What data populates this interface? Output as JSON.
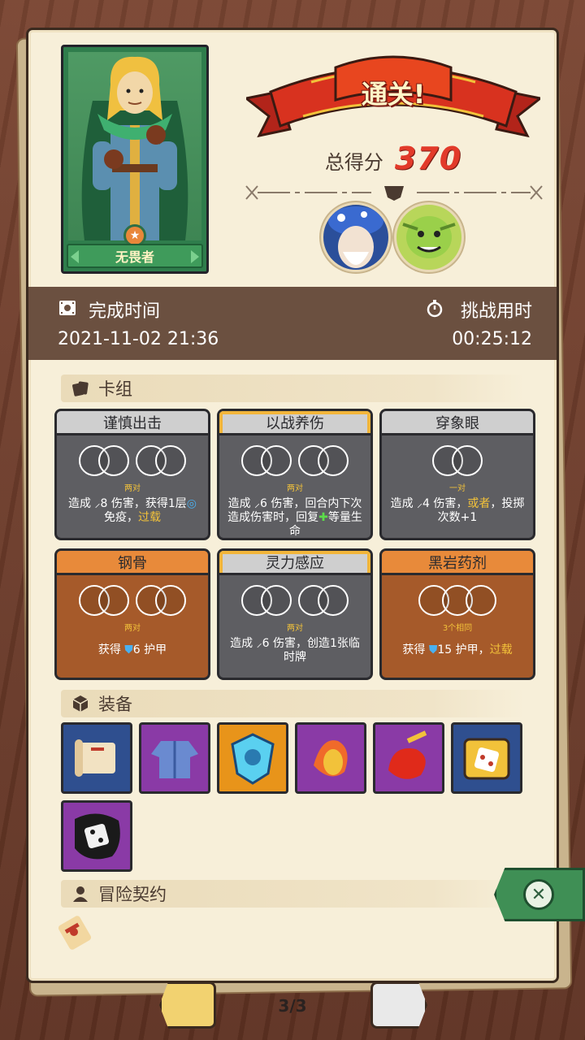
{
  "hero": {
    "name": "无畏者"
  },
  "result": {
    "banner": "通关!",
    "score_label": "总得分",
    "score_value": "370"
  },
  "times": {
    "finish_label": "完成时间",
    "finish_value": "2021-11-02 21:36",
    "challenge_label": "挑战用时",
    "challenge_value": "00:25:12"
  },
  "deck": {
    "title": "卡组",
    "cards": [
      {
        "name": "谨慎出击",
        "dice": "两对",
        "desc_a": "造成 ",
        "desc_b": "8 伤害，获得1层",
        "desc_c": "免疫，",
        "desc_hl": "过载"
      },
      {
        "name": "以战养伤",
        "dice": "两对",
        "desc_a": "造成 ",
        "desc_b": "6 伤害，回合内下次造成伤害时，回复",
        "desc_c": "等量生命"
      },
      {
        "name": "穿象眼",
        "dice": "一对",
        "desc_a": "造成 ",
        "desc_b": "4 伤害，",
        "desc_hl": "或者",
        "desc_c": "，投掷次数+1"
      },
      {
        "name": "钢骨",
        "dice": "两对",
        "desc_a": "获得 ",
        "desc_b": "6 护甲"
      },
      {
        "name": "灵力感应",
        "dice": "两对",
        "desc_a": "造成 ",
        "desc_b": "6 伤害，创造1张临时牌"
      },
      {
        "name": "黑岩药剂",
        "dice": "3个相同",
        "desc_a": "获得 ",
        "desc_b": "15 护甲，",
        "desc_hl": "过载"
      }
    ]
  },
  "equipment": {
    "title": "装备",
    "items": [
      {
        "icon": "scroll-icon",
        "color": "#2f4f8f"
      },
      {
        "icon": "tunic-icon",
        "color": "#8a3aa6"
      },
      {
        "icon": "ice-shield-icon",
        "color": "#e8941a"
      },
      {
        "icon": "fire-potion-icon",
        "color": "#8a3aa6"
      },
      {
        "icon": "flame-dagger-icon",
        "color": "#8a3aa6"
      },
      {
        "icon": "dice-box-icon",
        "color": "#2f4f8f"
      },
      {
        "icon": "cursed-dice-icon",
        "color": "#8a3aa6"
      }
    ]
  },
  "contract": {
    "title": "冒险契约",
    "icon": "contract-scroll-icon"
  },
  "pager": {
    "text": "3/3"
  }
}
